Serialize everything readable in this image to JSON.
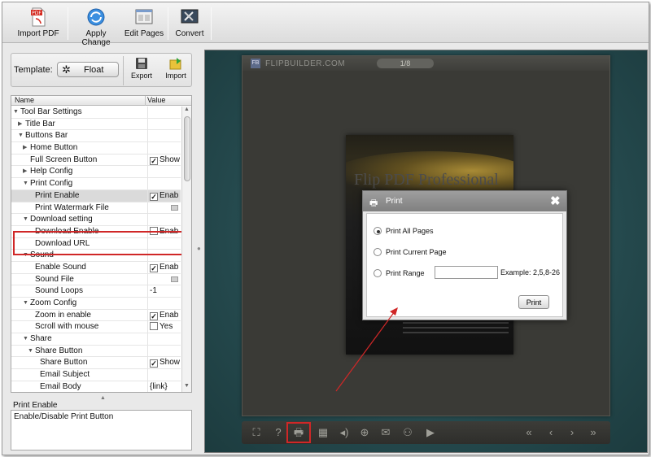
{
  "toolbar": {
    "import_pdf": "Import PDF",
    "apply_change": "Apply Change",
    "edit_pages": "Edit Pages",
    "convert": "Convert"
  },
  "template": {
    "label": "Template:",
    "value": "Float",
    "export": "Export",
    "import": "Import"
  },
  "tree": {
    "col_name": "Name",
    "col_value": "Value",
    "rows": [
      {
        "name": "Tool Bar Settings",
        "level": 0,
        "tw": "▼",
        "value": "",
        "vtype": "none"
      },
      {
        "name": "Title Bar",
        "level": 1,
        "tw": "▶",
        "value": "",
        "vtype": "none"
      },
      {
        "name": "Buttons Bar",
        "level": 1,
        "tw": "▼",
        "value": "",
        "vtype": "none"
      },
      {
        "name": "Home Button",
        "level": 2,
        "tw": "▶",
        "value": "",
        "vtype": "none"
      },
      {
        "name": "Full Screen Button",
        "level": 2,
        "tw": "",
        "value": "Show",
        "vtype": "check",
        "checked": true
      },
      {
        "name": "Help Config",
        "level": 2,
        "tw": "▶",
        "value": "",
        "vtype": "none"
      },
      {
        "name": "Print Config",
        "level": 2,
        "tw": "▼",
        "value": "",
        "vtype": "none"
      },
      {
        "name": "Print Enable",
        "level": 3,
        "tw": "",
        "value": "Enab",
        "vtype": "check",
        "checked": true,
        "selected": true
      },
      {
        "name": "Print Watermark File",
        "level": 3,
        "tw": "",
        "value": "",
        "vtype": "file"
      },
      {
        "name": "Download setting",
        "level": 2,
        "tw": "▼",
        "value": "",
        "vtype": "none"
      },
      {
        "name": "Download Enable",
        "level": 3,
        "tw": "",
        "value": "Enab",
        "vtype": "check",
        "checked": false
      },
      {
        "name": "Download URL",
        "level": 3,
        "tw": "",
        "value": "",
        "vtype": "none"
      },
      {
        "name": "Sound",
        "level": 2,
        "tw": "▼",
        "value": "",
        "vtype": "none"
      },
      {
        "name": "Enable Sound",
        "level": 3,
        "tw": "",
        "value": "Enab",
        "vtype": "check",
        "checked": true
      },
      {
        "name": "Sound File",
        "level": 3,
        "tw": "",
        "value": "",
        "vtype": "file"
      },
      {
        "name": "Sound Loops",
        "level": 3,
        "tw": "",
        "value": "-1",
        "vtype": "text"
      },
      {
        "name": "Zoom Config",
        "level": 2,
        "tw": "▼",
        "value": "",
        "vtype": "none"
      },
      {
        "name": "Zoom in enable",
        "level": 3,
        "tw": "",
        "value": "Enab",
        "vtype": "check",
        "checked": true
      },
      {
        "name": "Scroll with mouse",
        "level": 3,
        "tw": "",
        "value": "Yes",
        "vtype": "check",
        "checked": false
      },
      {
        "name": "Share",
        "level": 2,
        "tw": "▼",
        "value": "",
        "vtype": "none"
      },
      {
        "name": "Share Button",
        "level": 3,
        "tw": "▼",
        "value": "",
        "vtype": "none"
      },
      {
        "name": "Share Button",
        "level": 4,
        "tw": "",
        "value": "Show",
        "vtype": "check",
        "checked": true
      },
      {
        "name": "Email Subject",
        "level": 4,
        "tw": "",
        "value": "",
        "vtype": "none"
      },
      {
        "name": "Email Body",
        "level": 4,
        "tw": "",
        "value": "{link}",
        "vtype": "text"
      }
    ]
  },
  "description": {
    "title": "Print Enable",
    "text": "Enable/Disable Print Button"
  },
  "preview": {
    "brand": "FLIPBUILDER.COM",
    "page_indicator": "1/8",
    "page_title": "Flip PDF Professional"
  },
  "print_dialog": {
    "title": "Print",
    "close": "✖",
    "option_all": "Print All Pages",
    "option_current": "Print Current Page",
    "option_range": "Print Range",
    "range_value": "",
    "example": "Example: 2,5,8-26",
    "print_button": "Print",
    "selected_option": "all"
  },
  "colors": {
    "highlight": "#d02727",
    "preview_bg": "#2f5a5e",
    "book_frame": "#3a3a36"
  }
}
